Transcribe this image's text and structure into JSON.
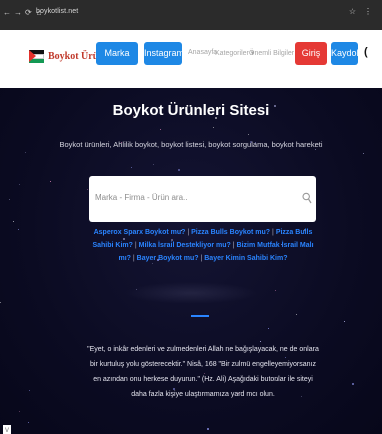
{
  "browser": {
    "url": "boykotlist.net",
    "nav_glyphs": [
      "←",
      "→",
      "⟳",
      "⌂"
    ],
    "ext_glyphs": [
      "☆",
      "⋮"
    ]
  },
  "header": {
    "logo_text": "Boykot Ürünleri",
    "nav_buttons": [
      "Marka Öner",
      "Instagram"
    ],
    "menu_links": [
      "Anasayfa",
      "Kategoriler ▾",
      "Önemli Bilgiler ▾"
    ],
    "login_label": "Giriş Yap",
    "register_label": "Kaydol",
    "theme_toggle": "(",
    "colors": {
      "primary": "#1e88e5",
      "danger": "#e53935",
      "logo": "#c0392b"
    }
  },
  "hero": {
    "title": "Boykot Ürünleri Sitesi",
    "subtitle": "Boykot ürünleri, Ahlilik boykot, boykot listesi, boykot sorgulama, boykot hareketi",
    "search_placeholder": "Marka - Firma - Ürün ara..",
    "link_color": "#2a84ff",
    "links": [
      "Asperox Sparx Boykot mu?",
      "Pizza Bulls Boykot mu?",
      "Pizza Bulls Sahibi Kim?",
      "Milka İsrail Destekliyor mu?",
      "Bizim Mutfak İsrail Malı mı?",
      "Bayer Boykot mu?",
      "Bayer Kimin Sahibi Kim?"
    ],
    "separator": " | ",
    "quote": "\"Eyet, o inkâr edenleri ve zulmedenleri Allah ne bağışlayacak, ne de onlara bir kurtuluş yolu gösterecektir.\" Nisâ, 168 \"Bir zulmü engelleyemiyorsanız en azından onu herkese duyurun.\" (Hz. Ali) Aşağıdaki butonlar ile siteyi daha fazla kişiye ulaştırmamıza yard mcı olun."
  },
  "corner_glyph": "v"
}
